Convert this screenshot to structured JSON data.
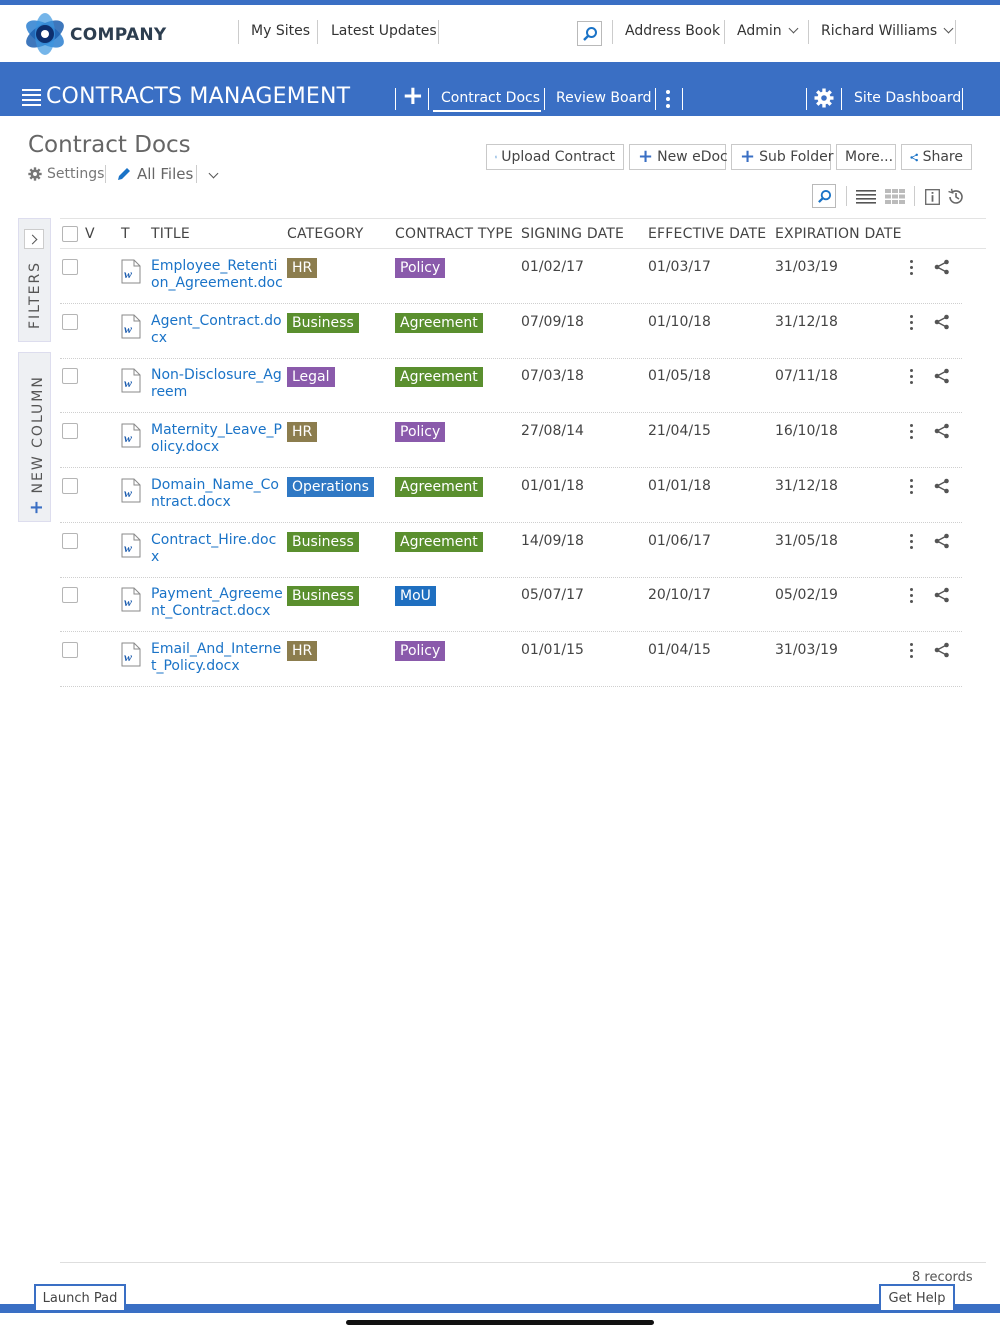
{
  "brand": {
    "name": "COMPANY"
  },
  "topnav": {
    "my_sites": "My Sites",
    "latest_updates": "Latest Updates",
    "address_book": "Address Book",
    "admin": "Admin",
    "user": "Richard Williams"
  },
  "appbar": {
    "title": "CONTRACTS MANAGEMENT",
    "tabs": [
      "Contract Docs",
      "Review Board"
    ],
    "site_dashboard": "Site Dashboard"
  },
  "page": {
    "title": "Contract Docs",
    "settings": "Settings",
    "view": "All Files"
  },
  "toolbar": {
    "upload": "Upload Contract",
    "new_edoc": "New eDoc",
    "sub_folder": "Sub Folder",
    "more": "More...",
    "share": "Share"
  },
  "side": {
    "filters": "FILTERS",
    "new_column": "NEW COLUMN"
  },
  "table": {
    "headers": {
      "v": "V",
      "t": "T",
      "title": "TITLE",
      "category": "CATEGORY",
      "contract_type": "CONTRACT TYPE",
      "signing_date": "SIGNING DATE",
      "effective_date": "EFFECTIVE DATE",
      "expiration_date": "EXPIRATION DATE"
    },
    "rows": [
      {
        "title": "Employee_Retention_Agreement.doc",
        "category": "HR",
        "type": "Policy",
        "signing": "01/02/17",
        "effective": "01/03/17",
        "expiration": "31/03/19"
      },
      {
        "title": "Agent_Contract.docx",
        "category": "Business",
        "type": "Agreement",
        "signing": "07/09/18",
        "effective": "01/10/18",
        "expiration": "31/12/18"
      },
      {
        "title": "Non-Disclosure_Agreem",
        "category": "Legal",
        "type": "Agreement",
        "signing": "07/03/18",
        "effective": "01/05/18",
        "expiration": "07/11/18"
      },
      {
        "title": "Maternity_Leave_Policy.docx",
        "category": "HR",
        "type": "Policy",
        "signing": "27/08/14",
        "effective": "21/04/15",
        "expiration": "16/10/18"
      },
      {
        "title": "Domain_Name_Contract.docx",
        "category": "Operations",
        "type": "Agreement",
        "signing": "01/01/18",
        "effective": "01/01/18",
        "expiration": "31/12/18"
      },
      {
        "title": "Contract_Hire.docx",
        "category": "Business",
        "type": "Agreement",
        "signing": "14/09/18",
        "effective": "01/06/17",
        "expiration": "31/05/18"
      },
      {
        "title": "Payment_Agreement_Contract.docx",
        "category": "Business",
        "type": "MoU",
        "signing": "05/07/17",
        "effective": "20/10/17",
        "expiration": "05/02/19"
      },
      {
        "title": "Email_And_Internet_Policy.docx",
        "category": "HR",
        "type": "Policy",
        "signing": "01/01/15",
        "effective": "01/04/15",
        "expiration": "31/03/19"
      }
    ]
  },
  "colors": {
    "accent": "#3a6fc4",
    "link": "#1a73c7",
    "HR": "#8c7d4e",
    "Business": "#5a8f2e",
    "Legal": "#8a5aab",
    "Operations": "#2f78c4",
    "Policy": "#8a5aab",
    "Agreement": "#5a8f2e",
    "MoU": "#1f6fc0"
  },
  "footer": {
    "records": "8 records",
    "launch_pad": "Launch Pad",
    "get_help": "Get Help"
  }
}
